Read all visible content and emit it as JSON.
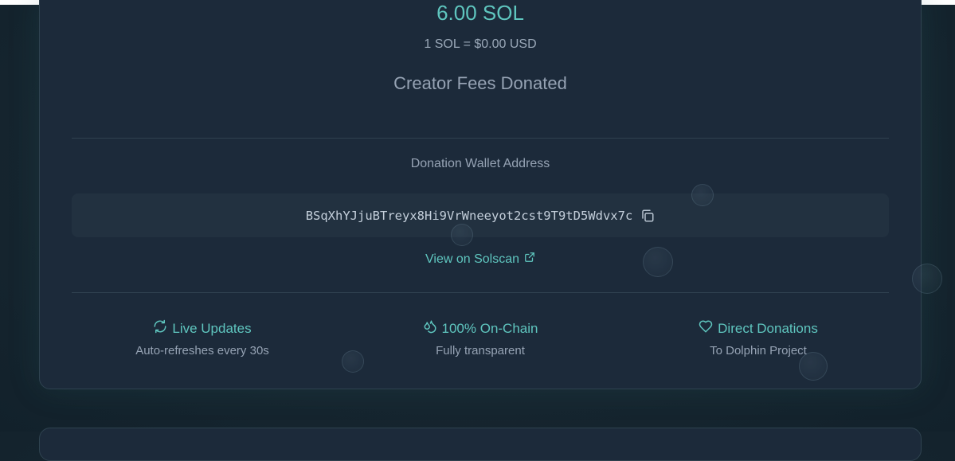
{
  "donation": {
    "amount": "6.00 SOL",
    "rate": "1 SOL = $0.00 USD",
    "subtitle": "Creator Fees Donated"
  },
  "wallet": {
    "label": "Donation Wallet Address",
    "address": "BSqXhYJjuBTreyx8Hi9VrWneeyot2cst9T9tD5Wdvx7c",
    "copy_icon": "copy-icon",
    "solscan_label": "View on Solscan",
    "solscan_icon": "external-link-icon"
  },
  "features": [
    {
      "title": "Live Updates",
      "desc": "Auto-refreshes every 30s",
      "icon": "refresh-icon"
    },
    {
      "title": "100% On-Chain",
      "desc": "Fully transparent",
      "icon": "droplets-icon"
    },
    {
      "title": "Direct Donations",
      "desc": "To Dolphin Project",
      "icon": "heart-icon"
    }
  ],
  "colors": {
    "accent": "#5fc6bf",
    "card_bg": "#1c2a3a",
    "page_bg": "#172630",
    "muted_text": "#96a3b4"
  }
}
